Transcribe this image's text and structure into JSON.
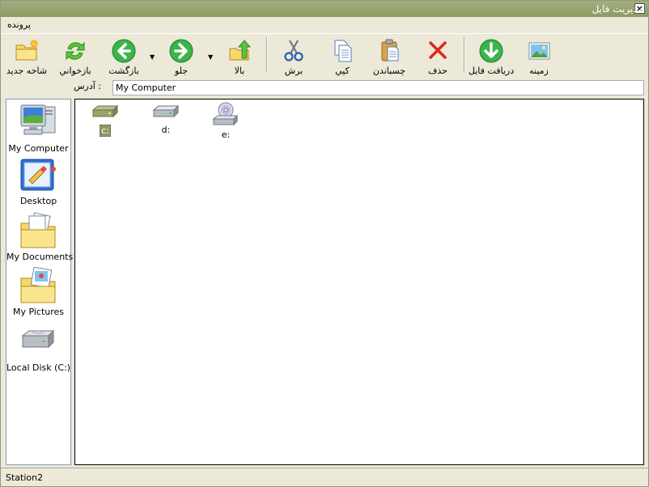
{
  "window": {
    "title": "مديريت فايل"
  },
  "menu": {
    "items": [
      {
        "label": "پرونده"
      }
    ]
  },
  "toolbar": {
    "new_folder": "شاخه جديد",
    "refresh": "بازخواني",
    "back": "بازگشت",
    "forward": "جلو",
    "up": "بالا",
    "cut": "برش",
    "copy": "کپي",
    "paste": "چسباندن",
    "delete": "حذف",
    "download": "دريافت فايل",
    "background": "زمينه"
  },
  "address": {
    "label": ": آدرس",
    "value": "My Computer"
  },
  "places": [
    {
      "label": "My Computer"
    },
    {
      "label": "Desktop"
    },
    {
      "label": "My Documents"
    },
    {
      "label": "My Pictures"
    },
    {
      "label": "Local Disk (C:)"
    }
  ],
  "drives": [
    {
      "label": "c:",
      "selected": true
    },
    {
      "label": "d:"
    },
    {
      "label": "e:"
    }
  ],
  "status": {
    "text": "Station2"
  },
  "colors": {
    "titlebar": "#8D9A64",
    "selection": "#8D9A64",
    "delete_red": "#E2261B",
    "nav_green": "#3BB54A"
  }
}
